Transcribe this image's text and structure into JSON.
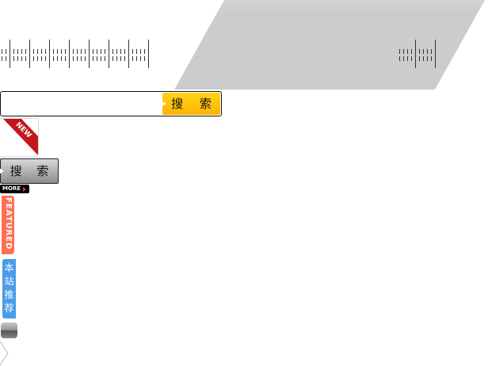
{
  "search_bar": {
    "placeholder": "",
    "button_label": "搜 索",
    "button_color": "#ffc000"
  },
  "new_badge": {
    "label": "NEW",
    "ribbon_color": "#c4161c"
  },
  "gray_search_button": {
    "label": "搜 索"
  },
  "more_badge": {
    "label": "MORE"
  },
  "featured_tab": {
    "label": "FEATURED",
    "color": "#ff7050"
  },
  "recommend_tab": {
    "label": "本站推荐",
    "color": "#4a9be8"
  },
  "colors": {
    "band": "#cccccc",
    "ticks": "#333333"
  }
}
